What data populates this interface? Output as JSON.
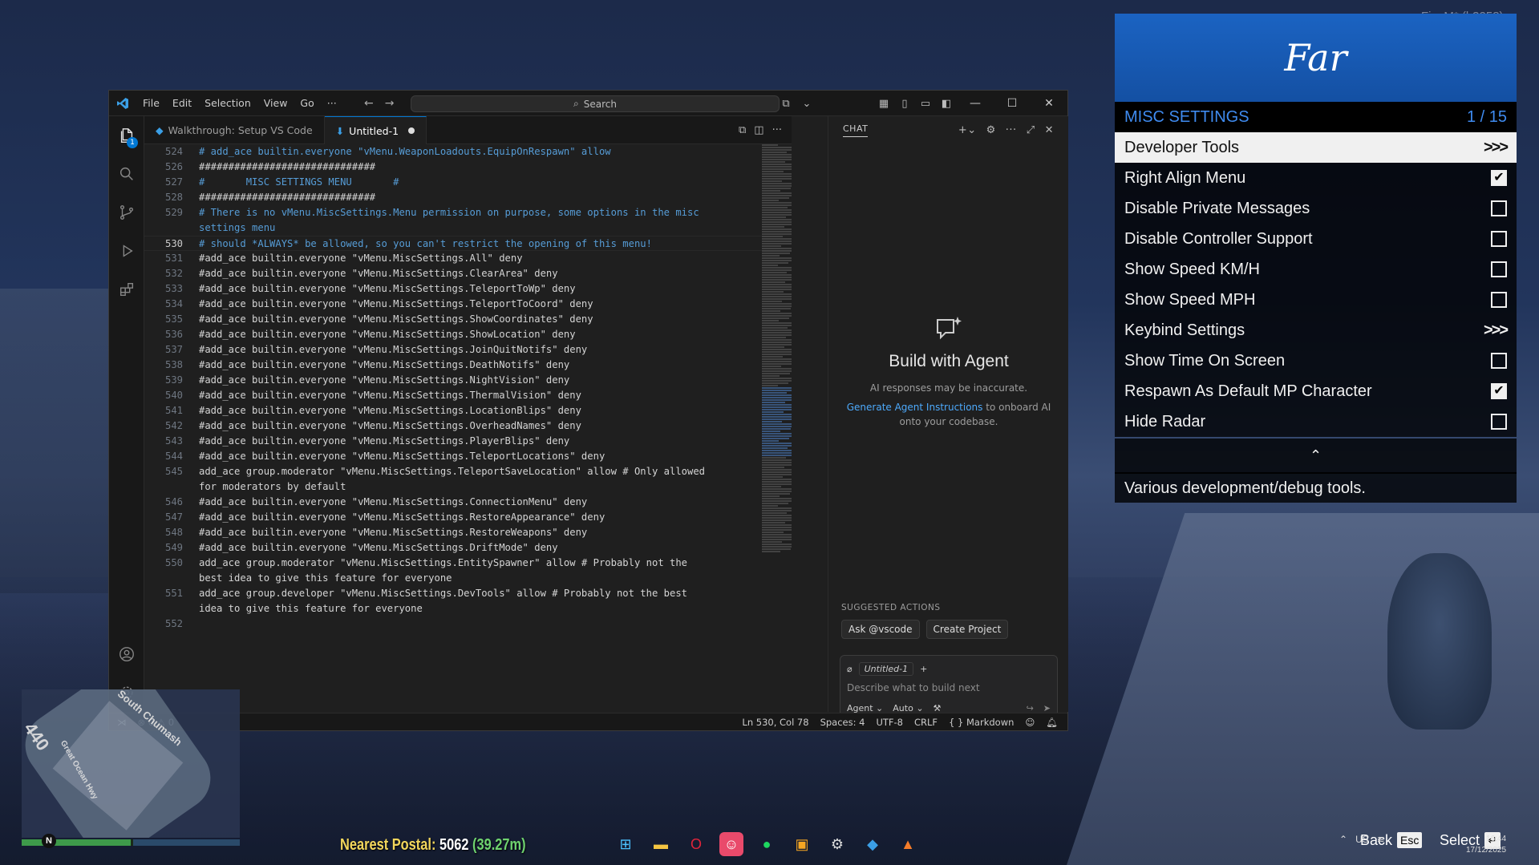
{
  "fivem_version": "FiveM* (b3258)",
  "vscode": {
    "menus": [
      "File",
      "Edit",
      "Selection",
      "View",
      "Go",
      "···"
    ],
    "search_placeholder": "Search",
    "activity_badge": "1",
    "tabs": [
      {
        "label": "Walkthrough: Setup VS Code",
        "active": false
      },
      {
        "label": "Untitled-1",
        "active": true,
        "dirty": true
      }
    ],
    "lines": [
      {
        "n": "524",
        "text": "# add_ace builtin.everyone \"vMenu.WeaponLoadouts.EquipOnRespawn\" allow",
        "comment": true
      },
      {
        "n": "526",
        "text": "##############################",
        "comment": false
      },
      {
        "n": "527",
        "text": "#       MISC SETTINGS MENU       #",
        "comment": true
      },
      {
        "n": "528",
        "text": "##############################",
        "comment": false
      },
      {
        "n": "529",
        "text": "# There is no vMenu.MiscSettings.Menu permission on purpose, some options in the misc",
        "comment": true
      },
      {
        "n": "",
        "text": "settings menu",
        "comment": true
      },
      {
        "n": "530",
        "text": "# should *ALWAYS* be allowed, so you can't restrict the opening of this menu!",
        "comment": true,
        "current": true
      },
      {
        "n": "531",
        "text": "#add_ace builtin.everyone \"vMenu.MiscSettings.All\" deny",
        "comment": false
      },
      {
        "n": "532",
        "text": "#add_ace builtin.everyone \"vMenu.MiscSettings.ClearArea\" deny",
        "comment": false
      },
      {
        "n": "533",
        "text": "#add_ace builtin.everyone \"vMenu.MiscSettings.TeleportToWp\" deny",
        "comment": false
      },
      {
        "n": "534",
        "text": "#add_ace builtin.everyone \"vMenu.MiscSettings.TeleportToCoord\" deny",
        "comment": false
      },
      {
        "n": "535",
        "text": "#add_ace builtin.everyone \"vMenu.MiscSettings.ShowCoordinates\" deny",
        "comment": false
      },
      {
        "n": "536",
        "text": "#add_ace builtin.everyone \"vMenu.MiscSettings.ShowLocation\" deny",
        "comment": false
      },
      {
        "n": "537",
        "text": "#add_ace builtin.everyone \"vMenu.MiscSettings.JoinQuitNotifs\" deny",
        "comment": false
      },
      {
        "n": "538",
        "text": "#add_ace builtin.everyone \"vMenu.MiscSettings.DeathNotifs\" deny",
        "comment": false
      },
      {
        "n": "539",
        "text": "#add_ace builtin.everyone \"vMenu.MiscSettings.NightVision\" deny",
        "comment": false
      },
      {
        "n": "540",
        "text": "#add_ace builtin.everyone \"vMenu.MiscSettings.ThermalVision\" deny",
        "comment": false
      },
      {
        "n": "541",
        "text": "#add_ace builtin.everyone \"vMenu.MiscSettings.LocationBlips\" deny",
        "comment": false
      },
      {
        "n": "542",
        "text": "#add_ace builtin.everyone \"vMenu.MiscSettings.OverheadNames\" deny",
        "comment": false
      },
      {
        "n": "543",
        "text": "#add_ace builtin.everyone \"vMenu.MiscSettings.PlayerBlips\" deny",
        "comment": false
      },
      {
        "n": "544",
        "text": "#add_ace builtin.everyone \"vMenu.MiscSettings.TeleportLocations\" deny",
        "comment": false
      },
      {
        "n": "545",
        "text": "add_ace group.moderator \"vMenu.MiscSettings.TeleportSaveLocation\" allow # Only allowed",
        "comment": false
      },
      {
        "n": "",
        "text": "for moderators by default",
        "comment": false
      },
      {
        "n": "546",
        "text": "#add_ace builtin.everyone \"vMenu.MiscSettings.ConnectionMenu\" deny",
        "comment": false
      },
      {
        "n": "547",
        "text": "#add_ace builtin.everyone \"vMenu.MiscSettings.RestoreAppearance\" deny",
        "comment": false
      },
      {
        "n": "548",
        "text": "#add_ace builtin.everyone \"vMenu.MiscSettings.RestoreWeapons\" deny",
        "comment": false
      },
      {
        "n": "549",
        "text": "#add_ace builtin.everyone \"vMenu.MiscSettings.DriftMode\" deny",
        "comment": false
      },
      {
        "n": "550",
        "text": "add_ace group.moderator \"vMenu.MiscSettings.EntitySpawner\" allow # Probably not the",
        "comment": false
      },
      {
        "n": "",
        "text": "best idea to give this feature for everyone",
        "comment": false
      },
      {
        "n": "551",
        "text": "add_ace group.developer \"vMenu.MiscSettings.DevTools\" allow # Probably not the best",
        "comment": false
      },
      {
        "n": "",
        "text": "idea to give this feature for everyone",
        "comment": false
      },
      {
        "n": "552",
        "text": "",
        "comment": false
      }
    ],
    "chat": {
      "header": "CHAT",
      "title": "Build with Agent",
      "disclaimer": "AI responses may be inaccurate.",
      "link_text": "Generate Agent Instructions",
      "link_rest": "to onboard AI",
      "link_rest2": "onto your codebase.",
      "suggested_label": "SUGGESTED ACTIONS",
      "suggested": [
        "Ask @vscode",
        "Create Project"
      ],
      "context_chip": "Untitled-1",
      "input_placeholder": "Describe what to build next",
      "mode": "Agent",
      "model": "Auto"
    },
    "status": {
      "errors": "0",
      "warnings": "0",
      "position": "Ln 530, Col 78",
      "spaces": "Spaces: 4",
      "encoding": "UTF-8",
      "eol": "CRLF",
      "language": "Markdown"
    }
  },
  "vmenu": {
    "title": "Far",
    "subtitle": "MISC SETTINGS",
    "counter": "1 / 15",
    "items": [
      {
        "label": "Developer Tools",
        "type": "submenu",
        "selected": true
      },
      {
        "label": "Right Align Menu",
        "type": "check",
        "checked": true
      },
      {
        "label": "Disable Private Messages",
        "type": "check",
        "checked": false
      },
      {
        "label": "Disable Controller Support",
        "type": "check",
        "checked": false
      },
      {
        "label": "Show Speed KM/H",
        "type": "check",
        "checked": false
      },
      {
        "label": "Show Speed MPH",
        "type": "check",
        "checked": false
      },
      {
        "label": "Keybind Settings",
        "type": "submenu",
        "selected": false
      },
      {
        "label": "Show Time On Screen",
        "type": "check",
        "checked": false
      },
      {
        "label": "Respawn As Default MP Character",
        "type": "check",
        "checked": true
      },
      {
        "label": "Hide Radar",
        "type": "check",
        "checked": false
      }
    ],
    "submenu_arrow": ">>>",
    "description": "Various development/debug tools."
  },
  "hud": {
    "radar_street1": "South Chumash",
    "radar_street2": "Great Ocean Hwy",
    "radar_number": "440",
    "compass": "N",
    "health_level": 0.5,
    "postal_label": "Nearest Postal:",
    "postal_number": "5062",
    "postal_distance": "(39.27m)"
  },
  "hints": {
    "back": "Back",
    "back_key": "Esc",
    "select": "Select",
    "select_key": "↵"
  },
  "tray": {
    "lang": "US",
    "time": "16:44",
    "date": "17/12/2025"
  }
}
